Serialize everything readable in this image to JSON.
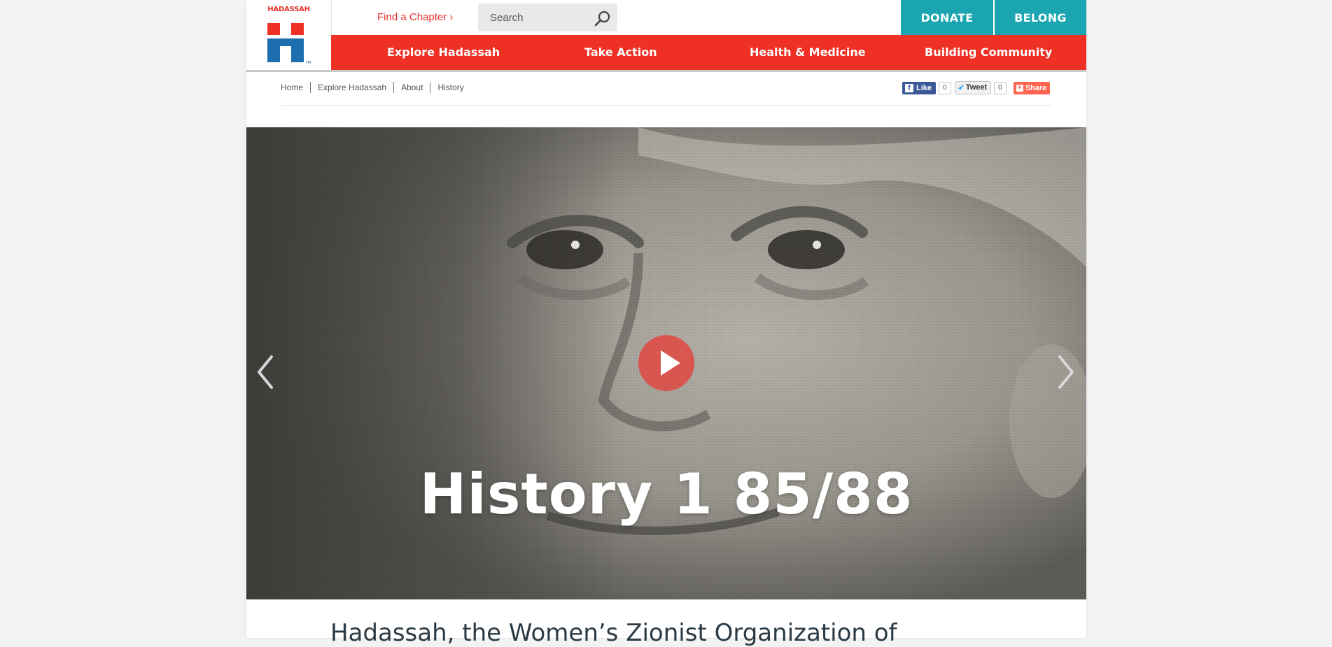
{
  "brand": {
    "name": "HADASSAH",
    "red": "#ee3124",
    "blue": "#1e6eb0",
    "teal": "#1aa5b0"
  },
  "header": {
    "find_chapter": "Find a Chapter ›",
    "search_placeholder": "Search",
    "donate": "DONATE",
    "belong": "BELONG"
  },
  "nav": {
    "items": [
      {
        "label": "Explore Hadassah"
      },
      {
        "label": "Take Action"
      },
      {
        "label": "Health & Medicine"
      },
      {
        "label": "Building Community"
      }
    ]
  },
  "breadcrumb": [
    "Home",
    "Explore Hadassah",
    "About",
    "History"
  ],
  "social": {
    "like_label": "Like",
    "like_count": "0",
    "tweet_label": "Tweet",
    "tweet_count": "0",
    "share_label": "Share"
  },
  "hero": {
    "title": "History 1 85/88",
    "play_icon": "play-icon",
    "prev_icon": "chevron-left-icon",
    "next_icon": "chevron-right-icon"
  },
  "intro_text": "Hadassah, the Women’s Zionist Organization of"
}
